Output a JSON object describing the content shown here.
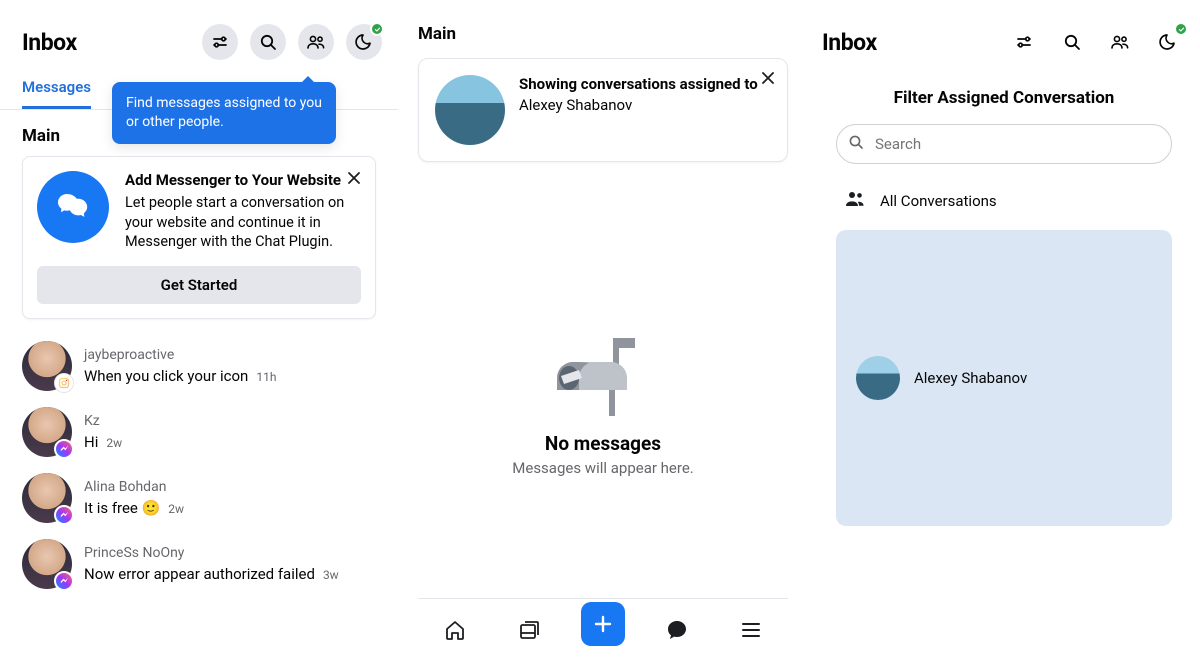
{
  "col1": {
    "header": {
      "title": "Inbox"
    },
    "tooltip": "Find messages assigned to you or other people.",
    "tabs": {
      "active": "Messages"
    },
    "section": "Main",
    "promo": {
      "title": "Add Messenger to Your Website",
      "copy": "Let people start a conversation on your website and continue it in Messenger with the Chat Plugin.",
      "cta": "Get Started"
    },
    "threads": [
      {
        "name": "jaybeproactive",
        "msg": "When you click your icon",
        "time": "11h",
        "badge": "ig"
      },
      {
        "name": "Kz",
        "msg": "Hi",
        "time": "2w",
        "badge": "msgr"
      },
      {
        "name": "Alina Bohdan",
        "msg": "It is free 🙂",
        "time": "2w",
        "badge": "msgr"
      },
      {
        "name": "PrinceSs NoOny",
        "msg": "Now error appear authorized failed",
        "time": "3w",
        "badge": "msgr"
      }
    ]
  },
  "col2": {
    "section": "Main",
    "assigned": {
      "line1": "Showing conversations assigned to",
      "line2": "Alexey Shabanov"
    },
    "empty": {
      "title": "No messages",
      "sub": "Messages will appear here."
    }
  },
  "col3": {
    "header": {
      "title": "Inbox"
    },
    "sheet": {
      "title": "Filter Assigned Conversation",
      "search_placeholder": "Search",
      "all": "All Conversations",
      "user": "Alexey Shabanov"
    }
  }
}
